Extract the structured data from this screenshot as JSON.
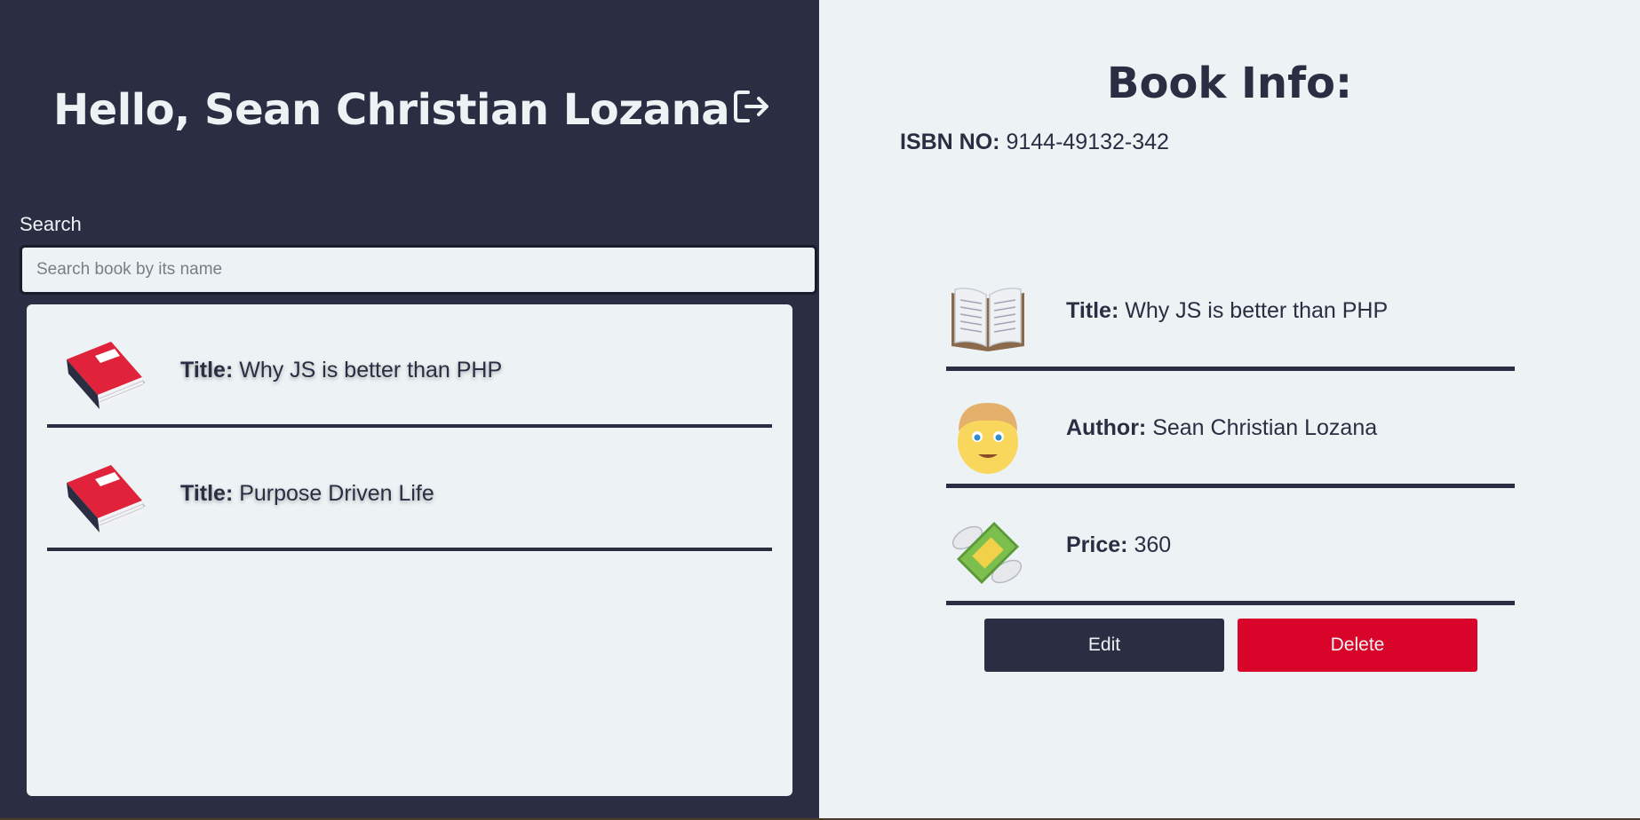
{
  "header": {
    "greeting": "Hello, Sean Christian Lozana",
    "logout_icon": "logout-icon"
  },
  "search": {
    "label": "Search",
    "placeholder": "Search book by its name",
    "value": ""
  },
  "books": [
    {
      "title_label": "Title:",
      "title": "Why JS is better than PHP",
      "icon": "red-book-icon"
    },
    {
      "title_label": "Title:",
      "title": "Purpose Driven Life",
      "icon": "red-book-icon"
    }
  ],
  "book_info": {
    "heading": "Book Info:",
    "isbn_label": "ISBN NO:",
    "isbn": "9144-49132-342",
    "title_label": "Title:",
    "title": "Why JS is better than PHP",
    "author_label": "Author:",
    "author": "Sean Christian Lozana",
    "price_label": "Price:",
    "price": "360",
    "icons": {
      "title": "open-book-icon",
      "author": "man-face-icon",
      "price": "money-wings-icon"
    }
  },
  "actions": {
    "edit_label": "Edit",
    "delete_label": "Delete"
  },
  "colors": {
    "dark": "#2b2d42",
    "light": "#edf2f4",
    "danger": "#d90429"
  }
}
